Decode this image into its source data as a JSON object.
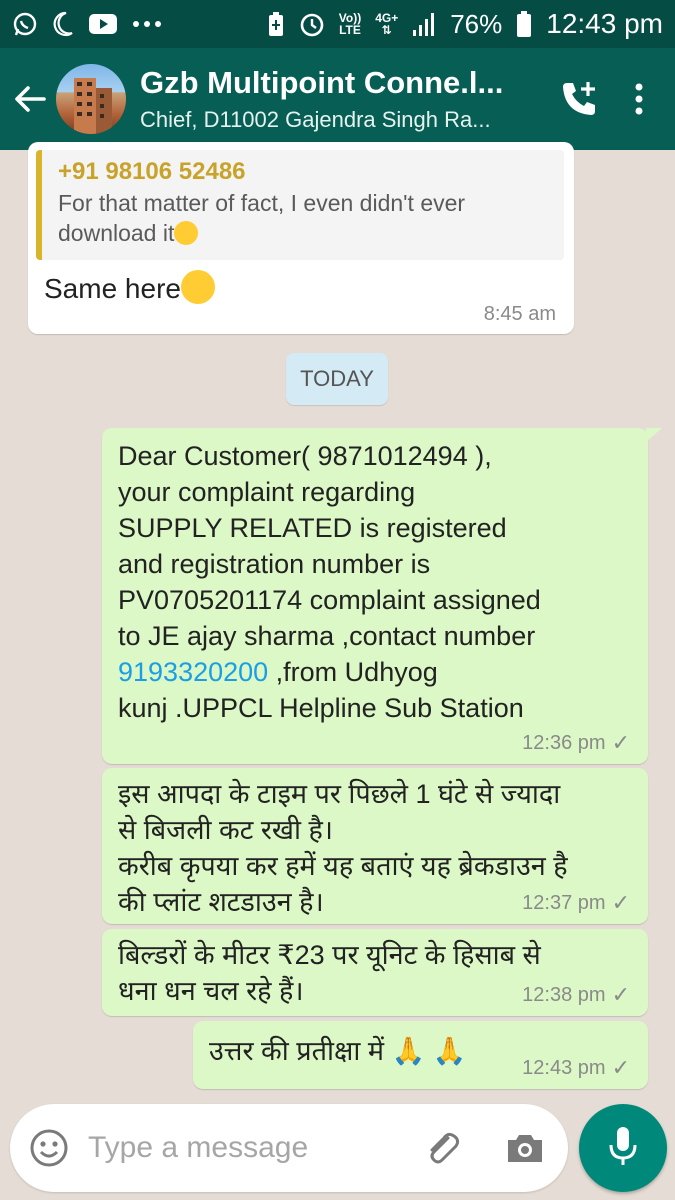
{
  "status_bar": {
    "left_icons": [
      "whatsapp-icon",
      "moon-icon",
      "youtube-icon",
      "more-notifications-icon"
    ],
    "volte_top": "Vo))",
    "volte_bottom": "LTE",
    "network": "4G+",
    "battery": "76%",
    "time": "12:43 pm"
  },
  "header": {
    "title": "Gzb Multipoint Conne.l...",
    "subtitle": "Chief, D11002 Gajendra Singh Ra...",
    "icons": [
      "back-arrow-icon",
      "add-call-icon",
      "overflow-menu-icon"
    ]
  },
  "messages": {
    "m1": {
      "quote_author": "+91 98106 52486",
      "quote_text": "For that matter of fact, I even didn't ever download it",
      "text": "Same here",
      "time": "8:45 am"
    },
    "date_divider": "TODAY",
    "m2": {
      "line1": "Dear Customer(  9871012494 ),",
      "line2": "your complaint regarding",
      "line3": "SUPPLY RELATED is registered",
      "line4": "and registration number is",
      "line5": "PV0705201174 complaint assigned",
      "line6": "to JE ajay sharma ,contact number",
      "phone_link": "9193320200",
      "line7_rest": " ,from Udhyog",
      "line8": "kunj .UPPCL Helpline Sub Station",
      "time": "12:36 pm",
      "status": "✓"
    },
    "m3": {
      "line1": "इस आपदा के टाइम पर पिछले 1 घंटे से ज्यादा",
      "line2": "से बिजली कट रखी है।",
      "line3": "करीब कृपया कर हमें यह बताएं यह ब्रेकडाउन है",
      "line4": "की प्लांट शटडाउन है।",
      "time": "12:37 pm",
      "status": "✓"
    },
    "m4": {
      "line1": "बिल्डरों के मीटर ₹23 पर यूनिट के हिसाब से",
      "line2": "धना धन चल रहे हैं।",
      "time": "12:38 pm",
      "status": "✓"
    },
    "m5": {
      "text": "उत्तर की प्रतीक्षा में",
      "emoji": "🙏 🙏",
      "time": "12:43 pm",
      "status": "✓"
    }
  },
  "input": {
    "placeholder": "Type a message",
    "icons": [
      "emoji-icon",
      "attach-icon",
      "camera-icon",
      "mic-icon"
    ]
  },
  "colors": {
    "header": "#075e54",
    "status_bar": "#054d44",
    "outgoing_bubble": "#dcf8c6",
    "incoming_bubble": "#ffffff",
    "chat_background": "#e5ddd5",
    "accent": "#00897b",
    "link": "#1a9ee6"
  }
}
